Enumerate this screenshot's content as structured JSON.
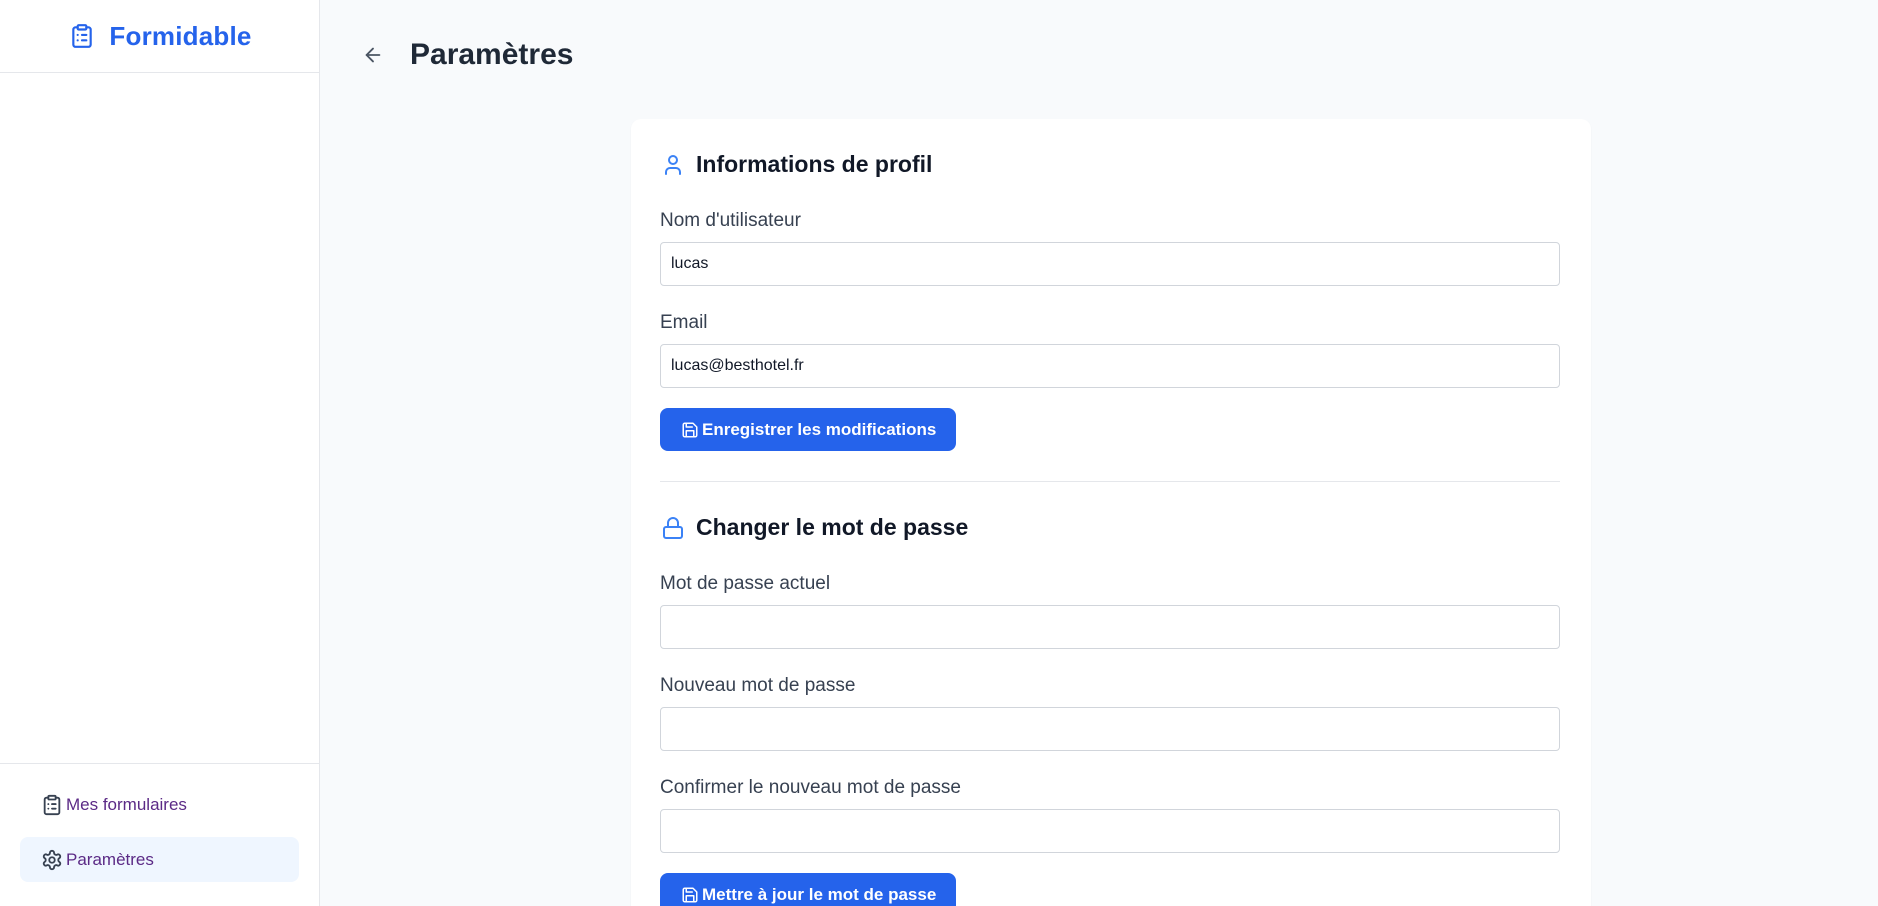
{
  "brand": {
    "name": "Formidable",
    "icon": "clipboard-list-icon",
    "color": "#2563eb"
  },
  "header": {
    "title": "Paramètres",
    "back_icon": "arrow-left-icon"
  },
  "profile": {
    "title": "Informations de profil",
    "icon": "user-icon",
    "username_label": "Nom d'utilisateur",
    "username_value": "lucas",
    "email_label": "Email",
    "email_value": "lucas@besthotel.fr",
    "save_label": "Enregistrer les modifications",
    "save_icon": "save-icon"
  },
  "password": {
    "title": "Changer le mot de passe",
    "icon": "lock-icon",
    "current_label": "Mot de passe actuel",
    "current_value": "",
    "new_label": "Nouveau mot de passe",
    "new_value": "",
    "confirm_label": "Confirmer le nouveau mot de passe",
    "confirm_value": "",
    "update_label": "Mettre à jour le mot de passe",
    "update_icon": "save-icon"
  },
  "sidebar": {
    "items": [
      {
        "label": "Mes formulaires",
        "icon": "clipboard-icon",
        "active": false
      },
      {
        "label": "Paramètres",
        "icon": "gear-icon",
        "active": true
      }
    ]
  },
  "colors": {
    "accent": "#2563eb",
    "nav_text": "#5b2a86",
    "active_bg": "#eff6ff"
  }
}
